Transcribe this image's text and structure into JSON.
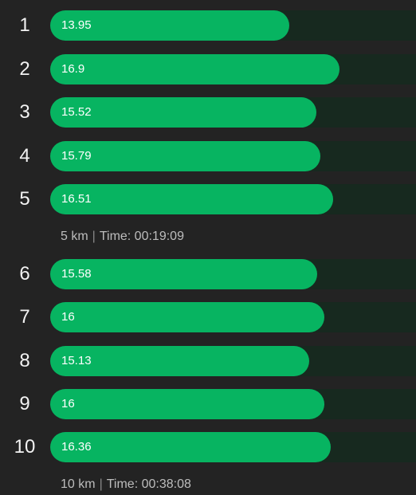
{
  "chart_data": {
    "type": "bar",
    "orientation": "horizontal",
    "categories": [
      "1",
      "2",
      "3",
      "4",
      "5",
      "6",
      "7",
      "8",
      "9",
      "10"
    ],
    "values": [
      13.95,
      16.9,
      15.52,
      15.79,
      16.51,
      15.58,
      16,
      15.13,
      16,
      16.36
    ],
    "colors": {
      "bar": "#07b461",
      "track": "#17291f",
      "background": "#232323"
    }
  },
  "splits": [
    {
      "after_index": 4,
      "distance": "5 km",
      "time_label": "Time: 00:19:09"
    },
    {
      "after_index": 9,
      "distance": "10 km",
      "time_label": "Time: 00:38:08"
    }
  ]
}
